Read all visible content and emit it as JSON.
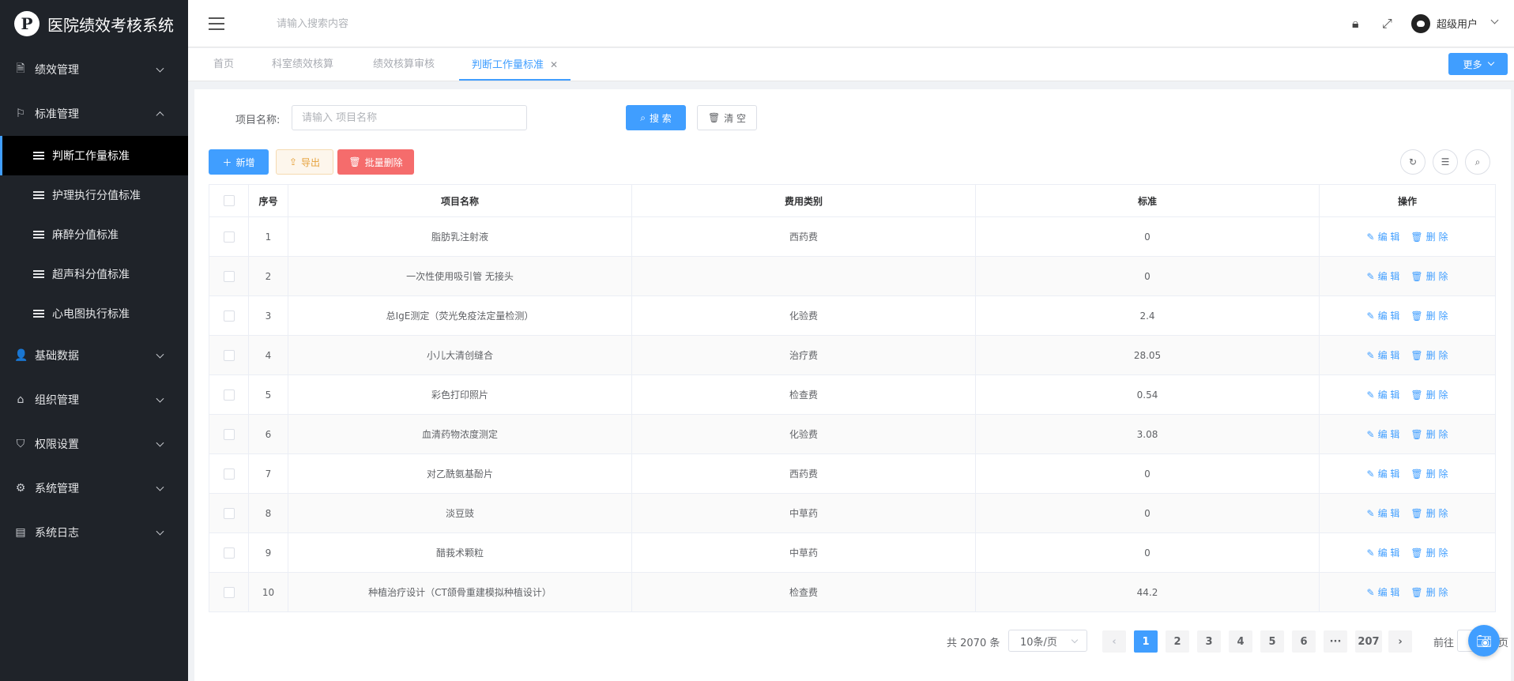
{
  "app": {
    "title": "医院绩效考核系统",
    "logo_glyph": "P"
  },
  "sidebar": {
    "groups": [
      {
        "label": "绩效管理",
        "icon": "document-icon",
        "expanded": false
      },
      {
        "label": "标准管理",
        "icon": "flag-icon",
        "expanded": true,
        "children": [
          {
            "label": "判断工作量标准",
            "active": true
          },
          {
            "label": "护理执行分值标准"
          },
          {
            "label": "麻醉分值标准"
          },
          {
            "label": "超声科分值标准"
          },
          {
            "label": "心电图执行标准"
          }
        ]
      },
      {
        "label": "基础数据",
        "icon": "user-icon",
        "expanded": false
      },
      {
        "label": "组织管理",
        "icon": "tag-icon",
        "expanded": false
      },
      {
        "label": "权限设置",
        "icon": "shield-icon",
        "expanded": false
      },
      {
        "label": "系统管理",
        "icon": "gear-icon",
        "expanded": false
      },
      {
        "label": "系统日志",
        "icon": "log-icon",
        "expanded": false
      }
    ]
  },
  "header": {
    "search_placeholder": "请输入搜索内容",
    "user_name": "超级用户"
  },
  "tabs": [
    {
      "label": "首页"
    },
    {
      "label": "科室绩效核算"
    },
    {
      "label": "绩效核算审核"
    },
    {
      "label": "判断工作量标准",
      "active": true,
      "closable": true
    }
  ],
  "more_label": "更多",
  "filter": {
    "label": "项目名称:",
    "placeholder": "请输入 项目名称",
    "search_label": "搜 索",
    "clear_label": "清 空"
  },
  "toolbar": {
    "add_label": "新增",
    "export_label": "导出",
    "batch_delete_label": "批量删除"
  },
  "table": {
    "columns": [
      "序号",
      "项目名称",
      "费用类别",
      "标准",
      "操作"
    ],
    "rows": [
      {
        "no": "1",
        "name": "脂肪乳注射液",
        "category": "西药费",
        "standard": "0"
      },
      {
        "no": "2",
        "name": "一次性使用吸引管 无接头",
        "category": "",
        "standard": "0"
      },
      {
        "no": "3",
        "name": "总IgE测定（荧光免疫法定量检测）",
        "category": "化验费",
        "standard": "2.4"
      },
      {
        "no": "4",
        "name": "小儿大清创缝合",
        "category": "治疗费",
        "standard": "28.05"
      },
      {
        "no": "5",
        "name": "彩色打印照片",
        "category": "检查费",
        "standard": "0.54"
      },
      {
        "no": "6",
        "name": "血清药物浓度测定",
        "category": "化验费",
        "standard": "3.08"
      },
      {
        "no": "7",
        "name": "对乙酰氨基酚片",
        "category": "西药费",
        "standard": "0"
      },
      {
        "no": "8",
        "name": "淡豆豉",
        "category": "中草药",
        "standard": "0"
      },
      {
        "no": "9",
        "name": "醋莪术颗粒",
        "category": "中草药",
        "standard": "0"
      },
      {
        "no": "10",
        "name": "种植治疗设计（CT颌骨重建模拟种植设计）",
        "category": "检查费",
        "standard": "44.2"
      }
    ],
    "edit_label": "编 辑",
    "delete_label": "删 除"
  },
  "pagination": {
    "total_text": "共 2070 条",
    "page_size": "10条/页",
    "pages": [
      "1",
      "2",
      "3",
      "4",
      "5",
      "6",
      "···",
      "207"
    ],
    "current": "1",
    "goto_label": "前往",
    "goto_suffix": "页"
  },
  "colors": {
    "primary": "#409eff",
    "sidebar_bg": "#1f2329",
    "danger": "#f56c6c",
    "warning": "#e6a23c"
  }
}
